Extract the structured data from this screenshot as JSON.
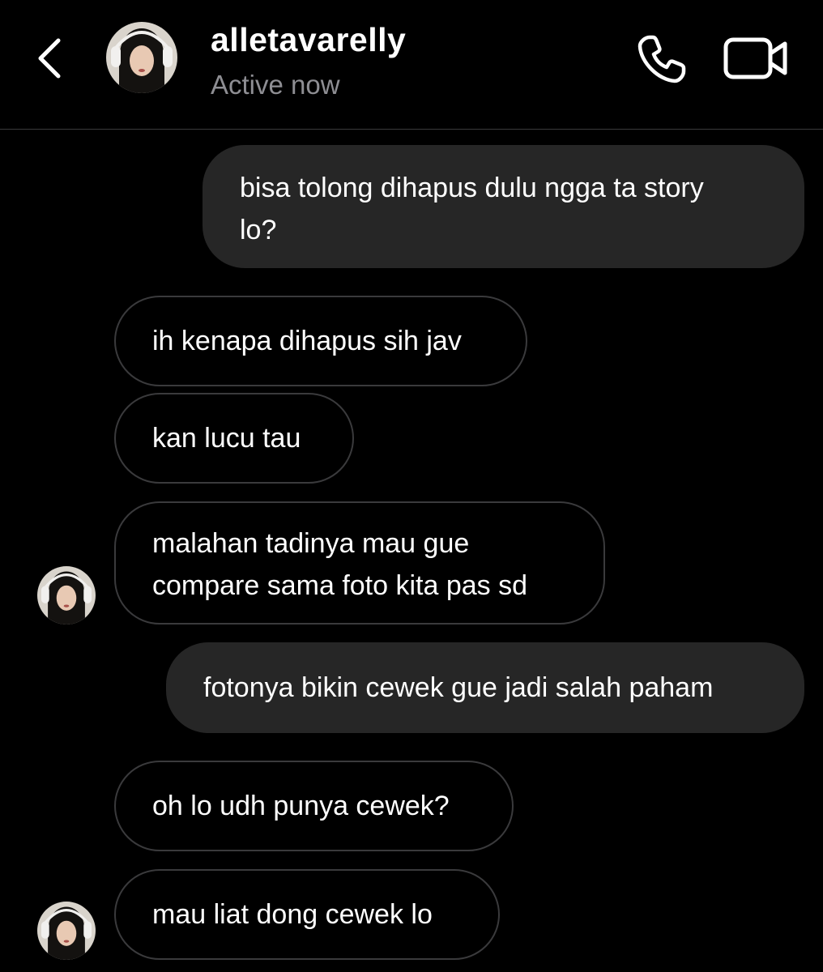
{
  "header": {
    "username": "alletavarelly",
    "status": "Active now",
    "icons": {
      "back": "chevron-left-icon",
      "call": "phone-icon",
      "video": "video-camera-icon"
    }
  },
  "messages": [
    {
      "from": "me",
      "text": "bisa tolong dihapus dulu ngga ta story\nlo?"
    },
    {
      "from": "them",
      "text": "ih kenapa dihapus sih jav"
    },
    {
      "from": "them",
      "text": "kan lucu tau"
    },
    {
      "from": "them",
      "text": "malahan tadinya mau gue\ncompare sama foto kita pas sd"
    },
    {
      "from": "me",
      "text": "fotonya bikin cewek gue jadi salah paham"
    },
    {
      "from": "them",
      "text": "oh lo udh punya cewek?"
    },
    {
      "from": "them",
      "text": "mau liat dong cewek lo"
    }
  ],
  "colors": {
    "background": "#000000",
    "sent_bubble": "#262626",
    "received_border": "#3a3a3c",
    "muted_text": "#8e8e93"
  }
}
